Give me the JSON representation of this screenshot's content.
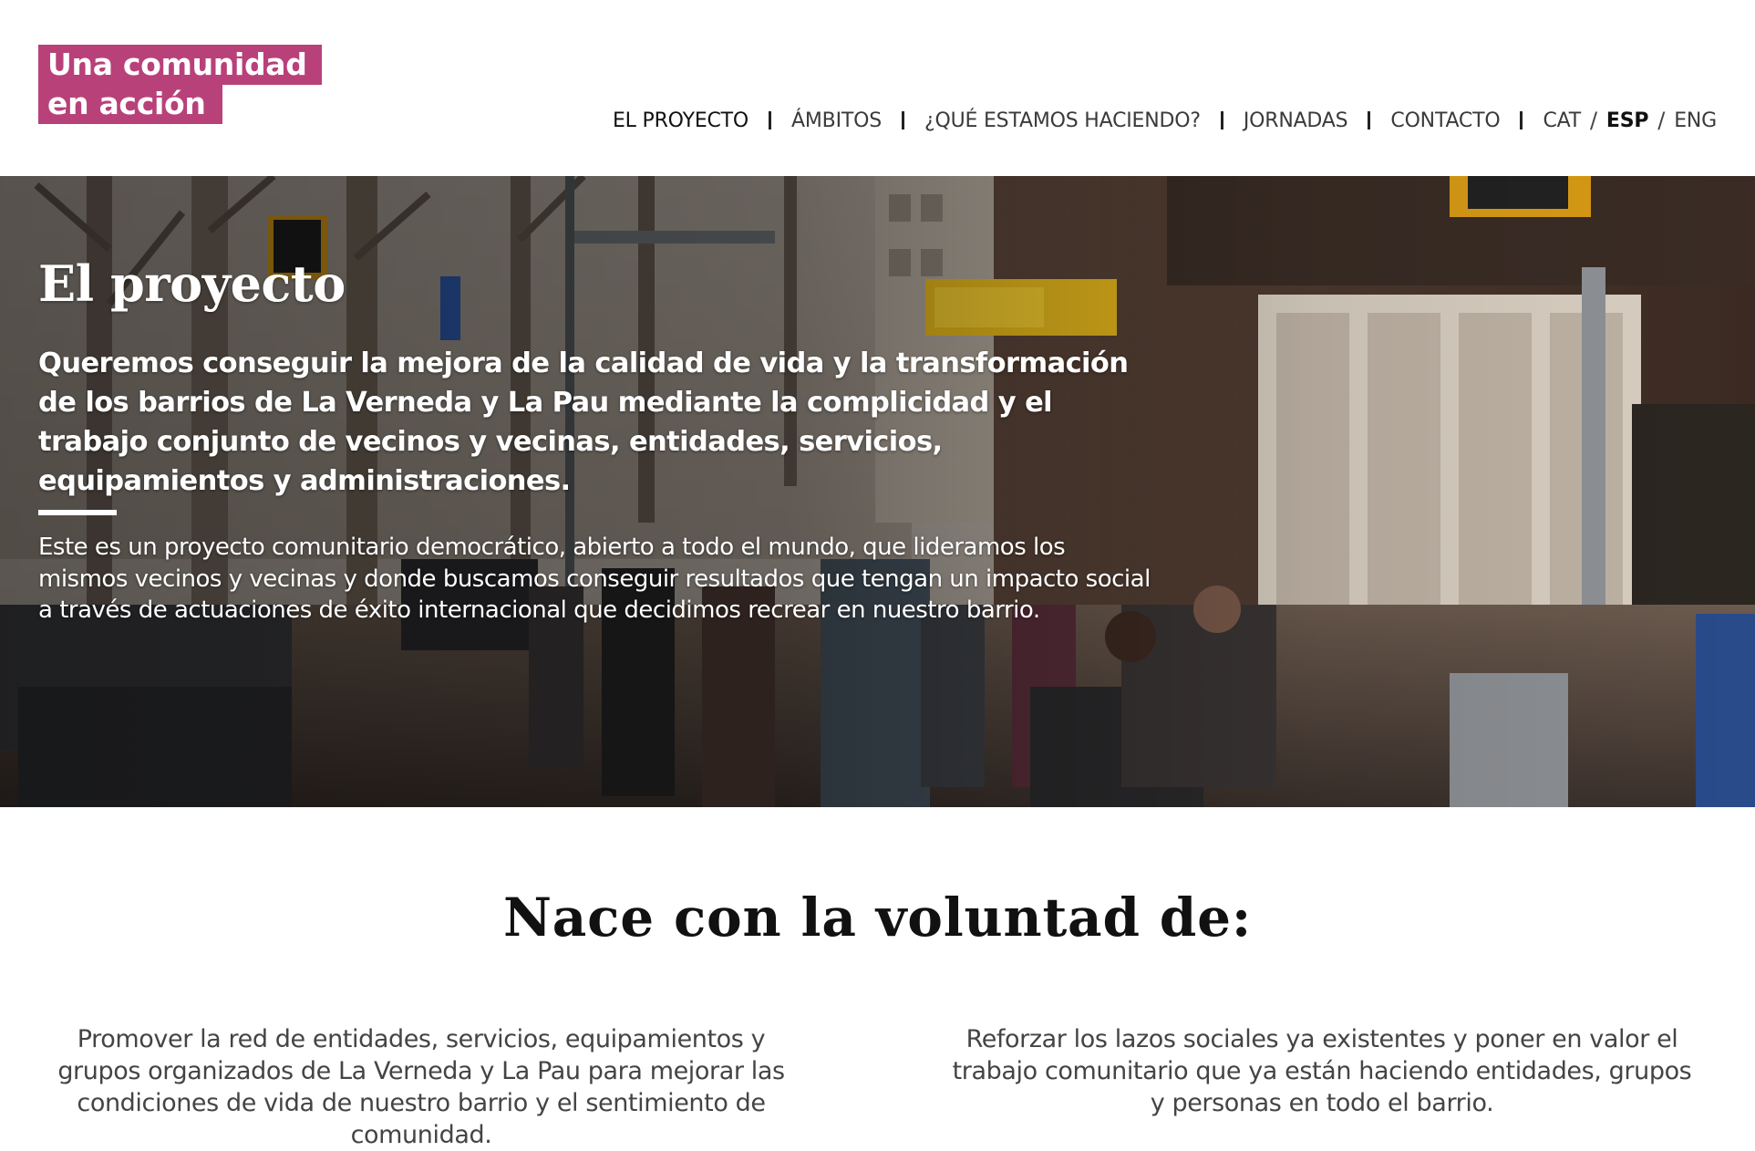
{
  "logo": {
    "line1": "Una comunidad",
    "line2": "en acción",
    "color": "#b8417a"
  },
  "nav": {
    "items": [
      {
        "label": "EL PROYECTO",
        "active": true
      },
      {
        "label": "ÁMBITOS",
        "active": false
      },
      {
        "label": "¿QUÉ ESTAMOS HACIENDO?",
        "active": false
      },
      {
        "label": "JORNADAS",
        "active": false
      },
      {
        "label": "CONTACTO",
        "active": false
      }
    ],
    "languages": [
      {
        "label": "CAT",
        "active": false
      },
      {
        "label": "ESP",
        "active": true
      },
      {
        "label": "ENG",
        "active": false
      }
    ],
    "language_separator": "/"
  },
  "hero": {
    "title": "El proyecto",
    "lead": "Queremos conseguir la mejora de la calidad de vida y la transformación de los barrios de La Verneda y La Pau mediante la complicidad y el trabajo conjunto de vecinos y vecinas, entidades, servicios, equipamientos y administraciones.",
    "body": "Este es un proyecto comunitario democrático, abierto a todo el mundo, que lideramos los mismos vecinos y vecinas y donde buscamos conseguir resultados que tengan un impacto social a través de actuaciones de éxito internacional que decidimos recrear en nuestro barrio."
  },
  "purpose": {
    "title": "Nace con la voluntad de:",
    "goals": [
      "Promover la red de entidades, servicios, equipamientos y grupos organizados de La Verneda y La Pau para mejorar las condiciones de vida de nuestro barrio y el sentimiento de comunidad.",
      "Reforzar los lazos sociales ya existentes y poner en valor el trabajo comunitario que ya están haciendo entidades, grupos y personas en todo el barrio."
    ]
  }
}
